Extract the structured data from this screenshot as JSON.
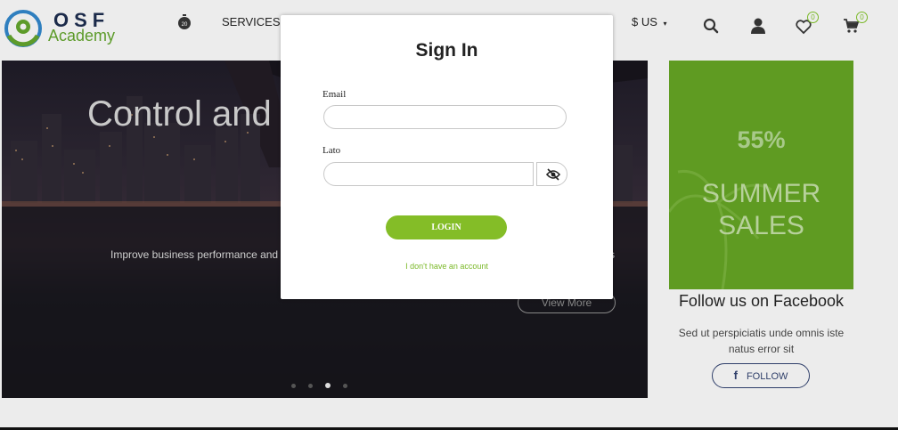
{
  "brand": {
    "name": "OSF",
    "sub": "Academy",
    "colors": {
      "accent": "#84bd27",
      "navy": "#1b2a4a"
    }
  },
  "header": {
    "timer_badge": "20",
    "services_label": "SERVICES",
    "currency_label": "$ US",
    "wishlist_count": "0",
    "cart_count": "0",
    "icons": [
      "search-icon",
      "user-icon",
      "heart-icon",
      "cart-icon"
    ]
  },
  "hero": {
    "title": "Control and",
    "subtitle": "Improve business performance and",
    "subtitle_tail": "s",
    "button_label": "View More",
    "slides": 4,
    "active_slide": 3
  },
  "promo": {
    "percent": "55%",
    "text_line1": "SUMMER",
    "text_line2": "SALES"
  },
  "facebook": {
    "title": "Follow us on Facebook",
    "description": "Sed ut perspiciatis unde omnis iste natus error sit",
    "button_label": "FOLLOW"
  },
  "signin": {
    "title": "Sign In",
    "email_label": "Email",
    "email_value": "",
    "password_label": "Lato",
    "password_value": "",
    "login_label": "LOGIN",
    "no_account_link": "I don't have an account"
  }
}
